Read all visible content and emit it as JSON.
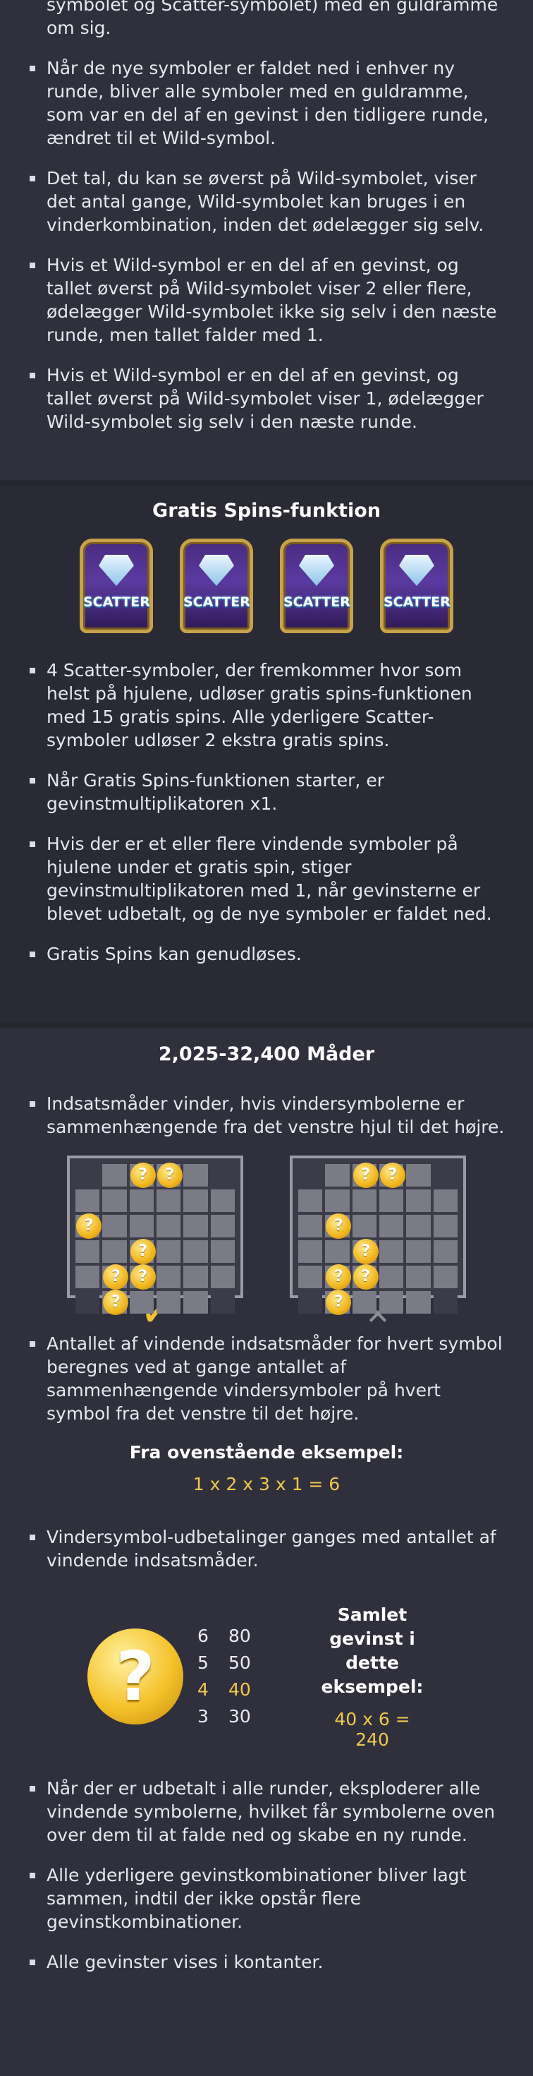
{
  "intro": {
    "continuation": "symbolet og Scatter-symbolet) med en guldramme om sig.",
    "items": [
      "Når de nye symboler er faldet ned i enhver ny runde, bliver alle symboler med en guldramme, som var en del af en gevinst i den tidligere runde, ændret til et Wild-symbol.",
      "Det tal, du kan se øverst på Wild-symbolet, viser det antal gange, Wild-symbolet kan bruges i en vinderkombination, inden det ødelægger sig selv.",
      "Hvis et Wild-symbol er en del af en gevinst, og tallet øverst på Wild-symbolet viser 2 eller flere, ødelægger Wild-symbolet ikke sig selv i den næste runde, men tallet falder med 1.",
      "Hvis et Wild-symbol er en del af en gevinst, og tallet øverst på Wild-symbolet viser 1, ødelægger Wild-symbolet sig selv i den næste runde."
    ]
  },
  "free_spins": {
    "title": "Gratis Spins-funktion",
    "scatter_label": "SCATTER",
    "items": [
      "4 Scatter-symboler, der fremkommer hvor som helst på hjulene, udløser gratis spins-funktionen med 15 gratis spins. Alle yderligere Scatter-symboler udløser 2 ekstra gratis spins.",
      "Når Gratis Spins-funktionen starter, er gevinstmultiplikatoren x1.",
      "Hvis der er et eller flere vindende symboler på hjulene under et gratis spin, stiger gevinstmultiplikatoren med 1, når gevinsterne er blevet udbetalt, og de nye symboler er faldet ned.",
      "Gratis Spins kan genudløses."
    ]
  },
  "ways": {
    "title": "2,025-32,400 Måder",
    "item1": "Indsatsmåder vinder, hvis vindersymbolerne er sammenhængende fra det venstre hjul til det højre.",
    "coin_glyph": "?",
    "valid_mark": "✔",
    "invalid_mark": "✕",
    "item2": "Antallet af vindende indsatsmåder for hvert symbol beregnes ved at gange antallet af sammenhængende vindersymboler på hvert symbol fra det venstre til det højre.",
    "example_title": "Fra ovenstående eksempel:",
    "example_formula": "1 x 2 x 3 x 1 = 6",
    "item3": "Vindersymbol-udbetalinger ganges med antallet af vindende indsatsmåder.",
    "paytable": [
      {
        "count": "6",
        "value": "80"
      },
      {
        "count": "5",
        "value": "50"
      },
      {
        "count": "4",
        "value": "40"
      },
      {
        "count": "3",
        "value": "30"
      }
    ],
    "total_title": "Samlet gevinst i dette eksempel:",
    "total_formula": "40 x 6 = 240",
    "items_end": [
      "Når der er udbetalt i alle runder, eksploderer alle vindende symbolerne, hvilket får symbolerne oven over dem til at falde ned og skabe en ny runde.",
      "Alle yderligere gevinstkombinationer bliver lagt sammen, indtil der ikke opstår flere gevinstkombinationer.",
      "Alle gevinster vises i kontanter."
    ]
  },
  "colors": {
    "accent": "#f1c84b",
    "valid": "#f2c232",
    "invalid": "#8e8e98"
  }
}
